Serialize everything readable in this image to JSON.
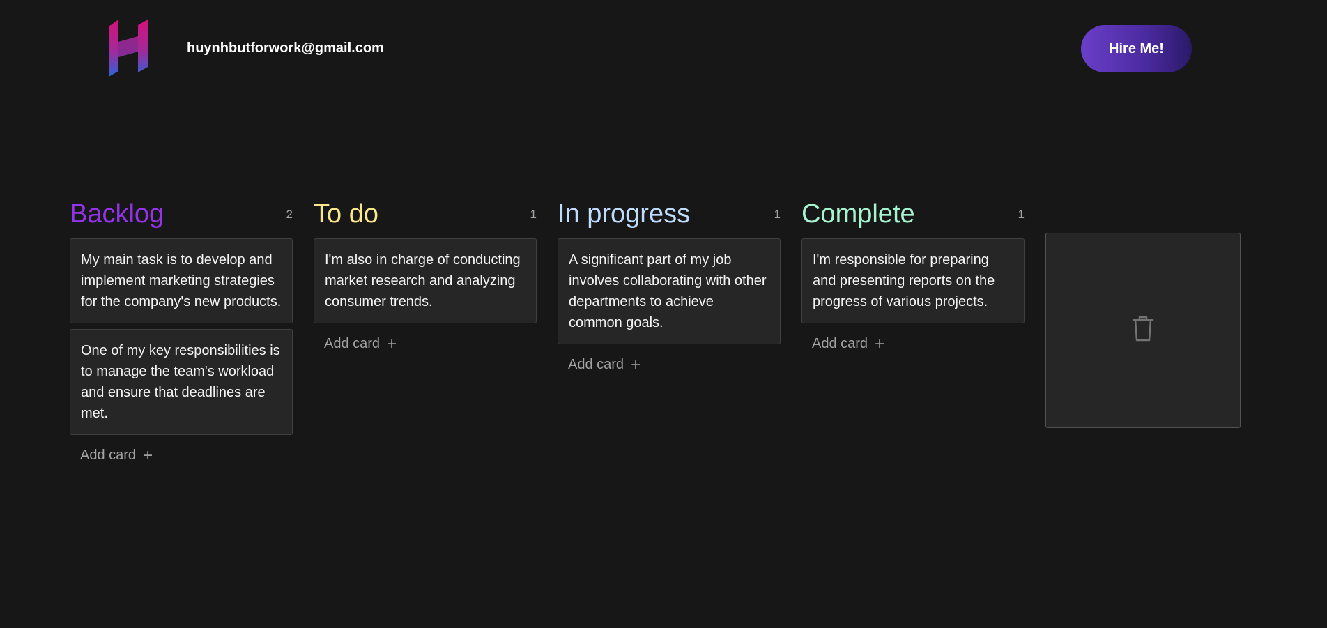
{
  "header": {
    "email": "huynhbutforwork@gmail.com",
    "hire_label": "Hire Me!"
  },
  "colors": {
    "backlog": "#9333ea",
    "todo": "#fde68a",
    "in_progress": "#bfdbfe",
    "complete": "#a7f3d0"
  },
  "columns": [
    {
      "title": "Backlog",
      "count": "2",
      "cards": [
        "My main task is to develop and implement marketing strategies for the company's new products.",
        "One of my key responsibilities is to manage the team's workload and ensure that deadlines are met."
      ],
      "add_label": "Add card"
    },
    {
      "title": "To do",
      "count": "1",
      "cards": [
        "I'm also in charge of conducting market research and analyzing consumer trends."
      ],
      "add_label": "Add card"
    },
    {
      "title": "In progress",
      "count": "1",
      "cards": [
        "A significant part of my job involves collaborating with other departments to achieve common goals."
      ],
      "add_label": "Add card"
    },
    {
      "title": "Complete",
      "count": "1",
      "cards": [
        "I'm responsible for preparing and presenting reports on the progress of various projects."
      ],
      "add_label": "Add card"
    }
  ],
  "icons": {
    "logo": "h-logo-icon",
    "add": "plus-icon",
    "trash": "trash-icon"
  }
}
